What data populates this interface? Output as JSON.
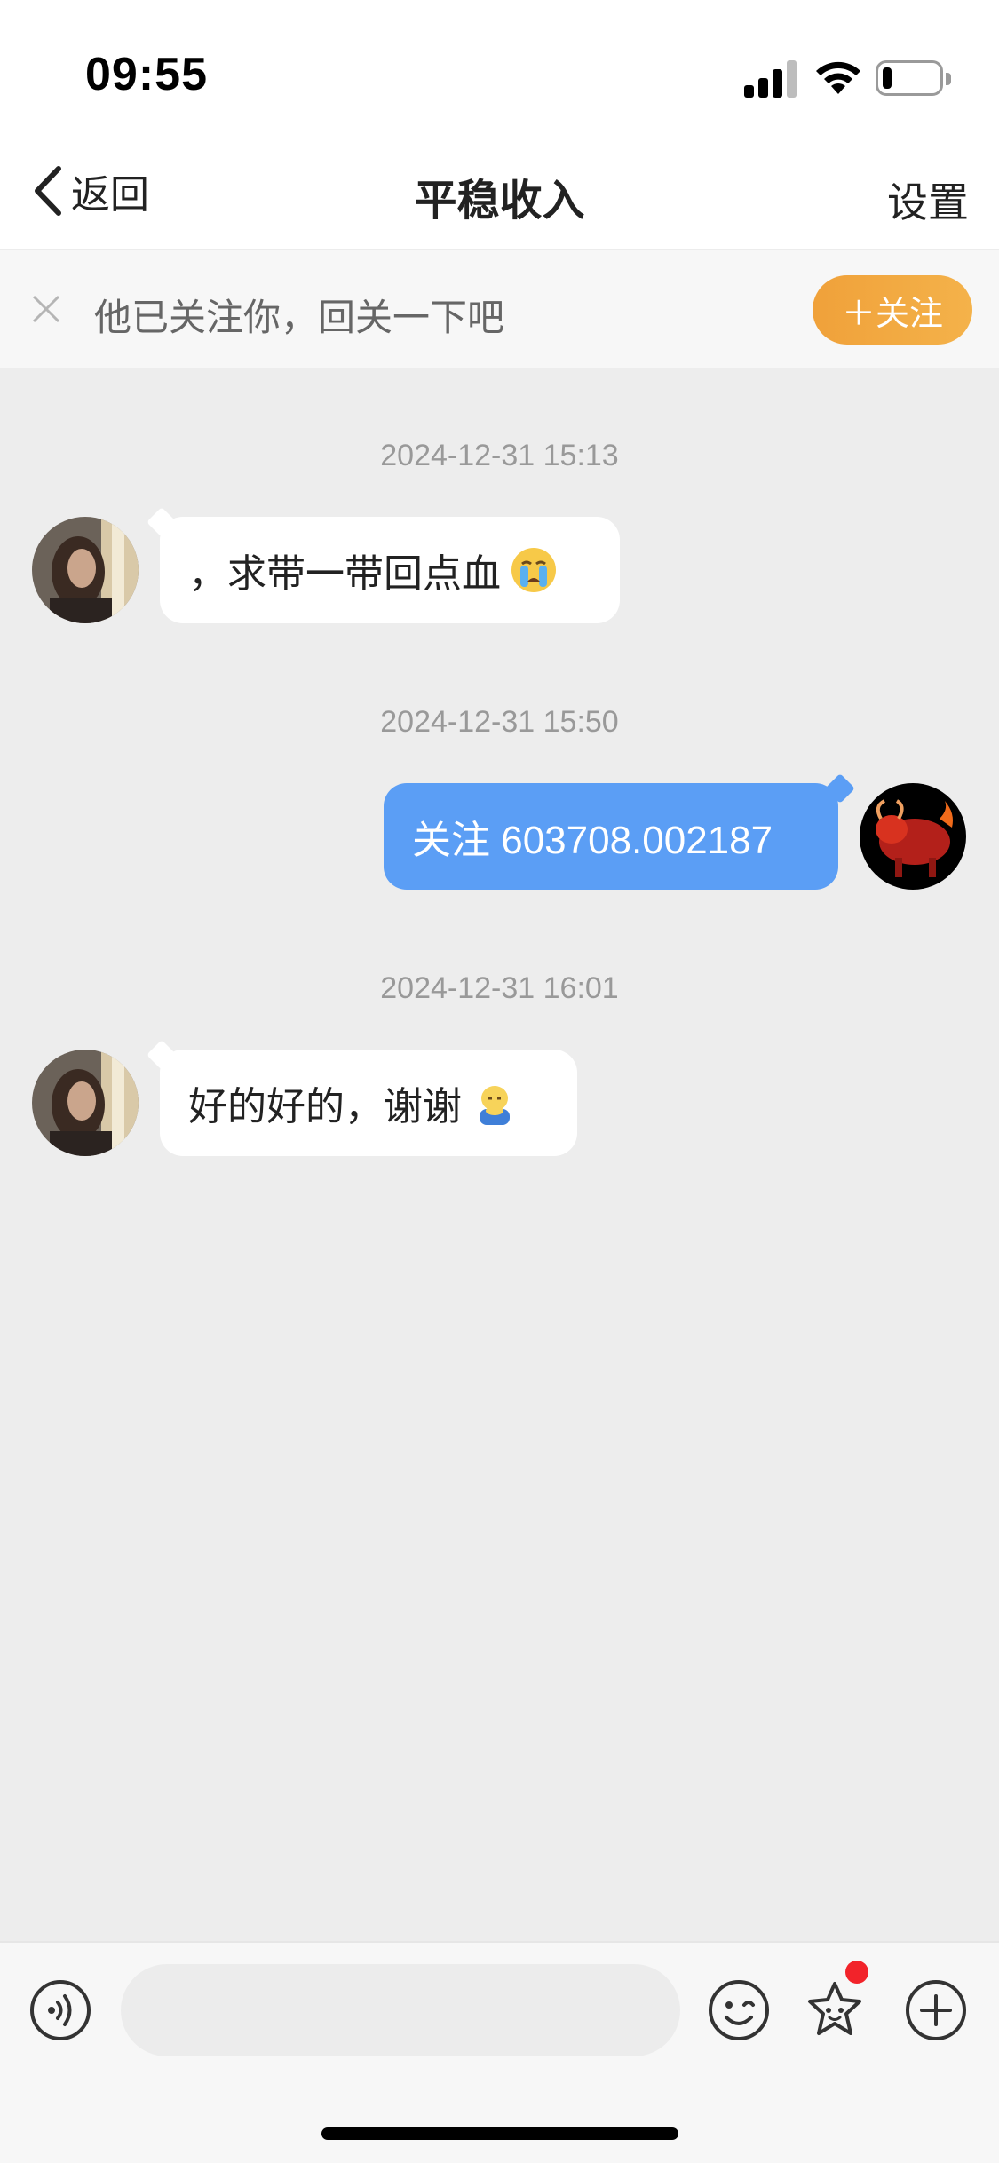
{
  "status_bar": {
    "time": "09:55"
  },
  "nav": {
    "back_label": "返回",
    "title": "平稳收入",
    "settings_label": "设置"
  },
  "follow_banner": {
    "text": "他已关注你，回关一下吧",
    "follow_button": "＋关注"
  },
  "messages": [
    {
      "timestamp": "2024-12-31 15:13",
      "direction": "incoming",
      "text": "，求带一带回点血",
      "emoji": "crying-face-icon"
    },
    {
      "timestamp": "2024-12-31 15:50",
      "direction": "outgoing",
      "text": "关注 603708.002187",
      "emoji": ""
    },
    {
      "timestamp": "2024-12-31 16:01",
      "direction": "incoming",
      "text": "好的好的，谢谢",
      "emoji": "bowing-person-icon"
    }
  ],
  "input": {
    "placeholder": "",
    "value": ""
  },
  "colors": {
    "outgoing_bubble": "#5b9ef5",
    "follow_button": "#f0a13a",
    "badge": "#f2232a",
    "chat_background": "#ededed"
  }
}
